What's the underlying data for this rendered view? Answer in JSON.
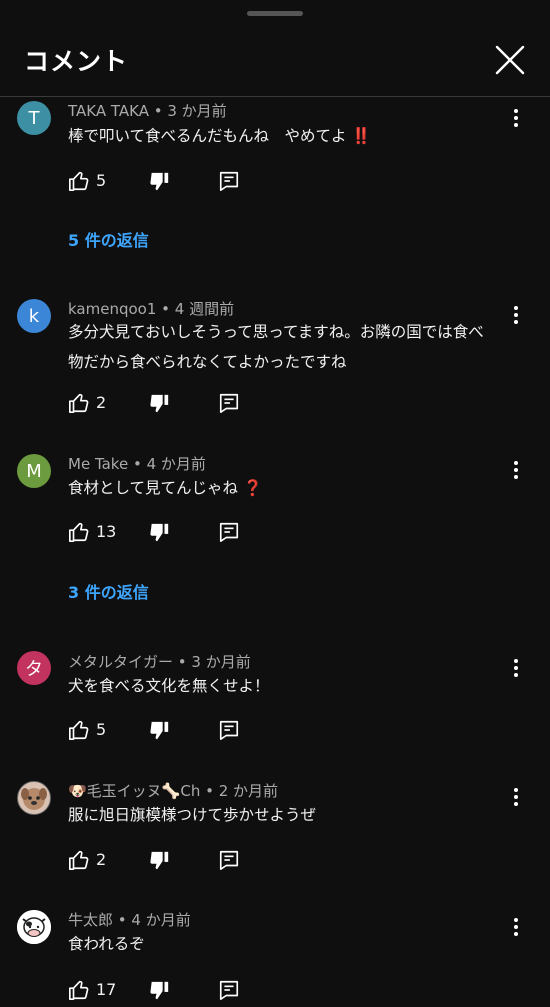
{
  "header": {
    "title": "コメント"
  },
  "colors": {
    "background": "#0f0f0f",
    "link": "#3ea6ff",
    "meta": "#aaaaaa"
  },
  "comments": [
    {
      "avatar_letter": "T",
      "avatar_color": "#3d8fa3",
      "meta": "TAKA TAKA • 3 か月前",
      "lines": [
        "棒で叩いて食べるんだもんね　やめてよ ‼️"
      ],
      "likes": "5",
      "replies_label": "5 件の返信"
    },
    {
      "avatar_letter": "k",
      "avatar_color": "#3b86d6",
      "meta": "kamenqoo1 • 4 週間前",
      "lines": [
        "多分犬見ておいしそうって思ってますね。お隣の国では食べ",
        "物だから食べられなくてよかったですね"
      ],
      "likes": "2",
      "replies_label": ""
    },
    {
      "avatar_letter": "M",
      "avatar_color": "#6c9a3e",
      "meta": "Me Take • 4 か月前",
      "lines": [
        "食材として見てんじゃね ❓"
      ],
      "likes": "13",
      "replies_label": "3 件の返信"
    },
    {
      "avatar_letter": "タ",
      "avatar_color": "#c2335f",
      "meta": "メタルタイガー • 3 か月前",
      "lines": [
        "犬を食べる文化を無くせよ！"
      ],
      "likes": "5",
      "replies_label": ""
    },
    {
      "avatar_letter": "",
      "avatar_color": "#d9c2b4",
      "meta": "🐶毛玉イッヌ🦴Ch • 2 か月前",
      "lines": [
        "服に旭日旗模様つけて歩かせようぜ"
      ],
      "likes": "2",
      "replies_label": ""
    },
    {
      "avatar_letter": "",
      "avatar_color": "#ffffff",
      "meta": "牛太郎 • 4 か月前",
      "lines": [
        "食われるぞ"
      ],
      "likes": "17",
      "replies_label": ""
    }
  ]
}
